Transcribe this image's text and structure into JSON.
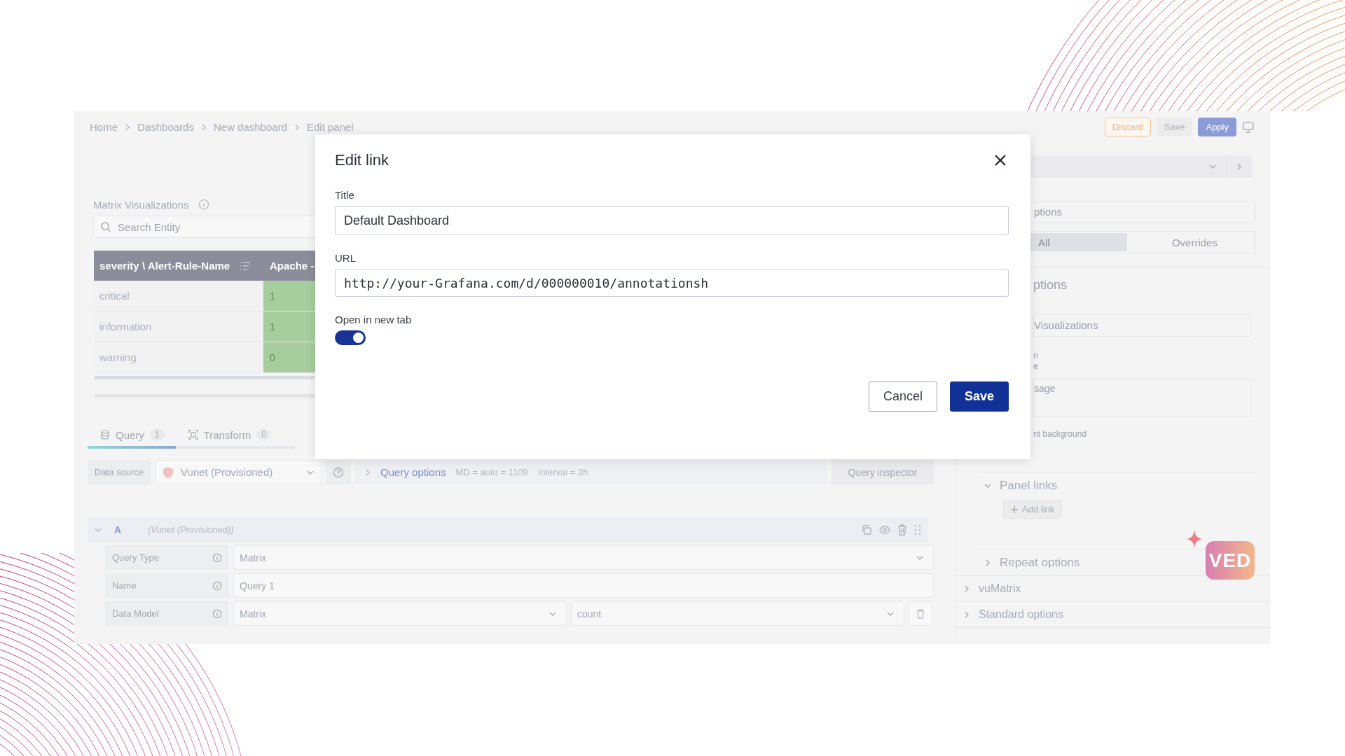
{
  "breadcrumb": [
    "Home",
    "Dashboards",
    "New dashboard",
    "Edit panel"
  ],
  "toolbar": {
    "discard": "Discard",
    "save": "Save",
    "apply": "Apply"
  },
  "panel": {
    "title": "Matrix Visualizations",
    "search": {
      "placeholder": "Search Entity"
    },
    "table": {
      "columns": [
        "severity \\ Alert-Rule-Name",
        "Apache -"
      ],
      "rows": [
        {
          "label": "critical",
          "value": "1"
        },
        {
          "label": "information",
          "value": "1"
        },
        {
          "label": "warning",
          "value": "0"
        }
      ]
    }
  },
  "query_tabs": [
    {
      "label": "Query",
      "count": "1",
      "selected": true,
      "kind": "query"
    },
    {
      "label": "Transform",
      "count": "0",
      "selected": false,
      "kind": "transform"
    }
  ],
  "data_source": {
    "label": "Data source",
    "value": "Vunet (Provisioned)",
    "query_options": "Query options",
    "max_data_points": "MD = auto = 1109",
    "interval": "Interval = 3h",
    "inspector": "Query inspector"
  },
  "query": {
    "letter": "A",
    "source": "(Vunet (Provisioned))",
    "expanded": true,
    "fields": [
      {
        "kind": "select",
        "label": "Query Type",
        "value": "Matrix"
      },
      {
        "kind": "input",
        "label": "Name",
        "value": "Query 1"
      },
      {
        "kind": "pair",
        "label": "Data Model",
        "value": "Matrix",
        "value_2": "count"
      }
    ]
  },
  "options_pane": {
    "search": {
      "placeholder": "ptions"
    },
    "tabs": [
      {
        "label": "All",
        "selected": true
      },
      {
        "label": "Overrides",
        "selected": false
      }
    ],
    "heading": "ptions",
    "title_value": "Visualizations",
    "label_fragments": [
      "n",
      "e"
    ],
    "description_value": "sage",
    "transparent_label": "nt background",
    "sections": [
      {
        "label": "Panel links",
        "expanded": true,
        "action": "Add link"
      },
      {
        "label": "Repeat options",
        "expanded": false
      }
    ],
    "categories": [
      {
        "label": "vuMatrix",
        "expanded": false
      },
      {
        "label": "Standard options",
        "expanded": false
      }
    ]
  },
  "assistant_badge": {
    "label": "VED"
  },
  "dialog": {
    "title": "Edit link",
    "fields": [
      {
        "kind": "text",
        "label": "Title",
        "value": "Default Dashboard"
      },
      {
        "kind": "url",
        "label": "URL",
        "value": "http://your-Grafana.com/d/000000010/annotationsh"
      }
    ],
    "open_in_new_tab": {
      "label": "Open in new tab",
      "on": true
    },
    "buttons": [
      {
        "kind": "secondary",
        "label": "Cancel"
      },
      {
        "kind": "primary",
        "label": "Save"
      }
    ]
  }
}
